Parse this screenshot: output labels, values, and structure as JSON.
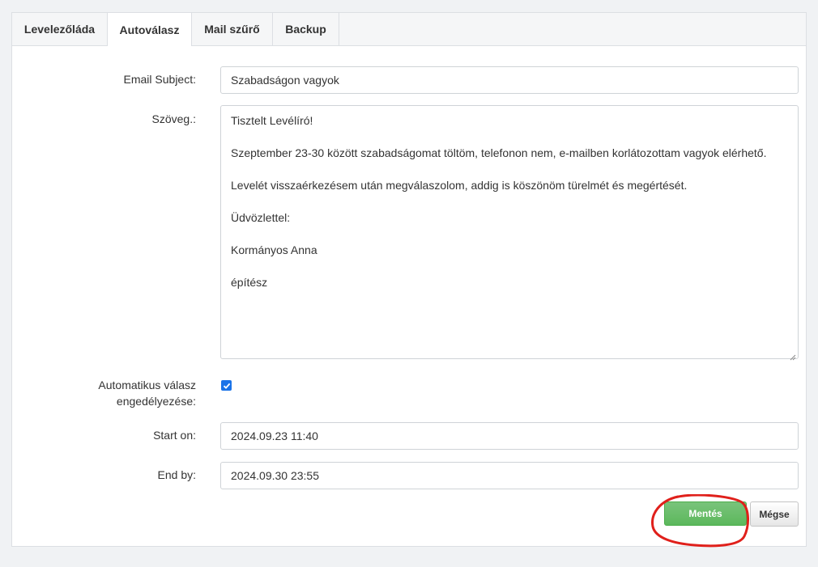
{
  "tabs": [
    {
      "label": "Levelezőláda",
      "active": false
    },
    {
      "label": "Autoválasz",
      "active": true
    },
    {
      "label": "Mail szűrő",
      "active": false
    },
    {
      "label": "Backup",
      "active": false
    }
  ],
  "form": {
    "subject_label": "Email Subject:",
    "subject_value": "Szabadságon vagyok",
    "body_label": "Szöveg.:",
    "body_lines": [
      "Tisztelt Levélíró!",
      "Szeptember 23-30 között szabadságomat töltöm, telefonon nem, e-mailben korlátozottam vagyok elérhető.",
      "Levelét visszaérkezésem után megválaszolom, addig is köszönöm türelmét és megértését.",
      "Üdvözlettel:",
      "Kormányos Anna",
      "építész"
    ],
    "auto_reply_label_line1": "Automatikus válasz",
    "auto_reply_label_line2": "engedélyezése:",
    "auto_reply_enabled": true,
    "start_label": "Start on:",
    "start_value": "2024.09.23 11:40",
    "end_label": "End by:",
    "end_value": "2024.09.30 23:55"
  },
  "buttons": {
    "save_label": "Mentés",
    "cancel_label": "Mégse"
  },
  "colors": {
    "save_button": "#5cb85c",
    "checkbox": "#1a73e8",
    "highlight_annotation": "#e0201b"
  },
  "icons": {
    "checkbox": "check-icon",
    "textarea_resize": "resize-grip-icon"
  }
}
